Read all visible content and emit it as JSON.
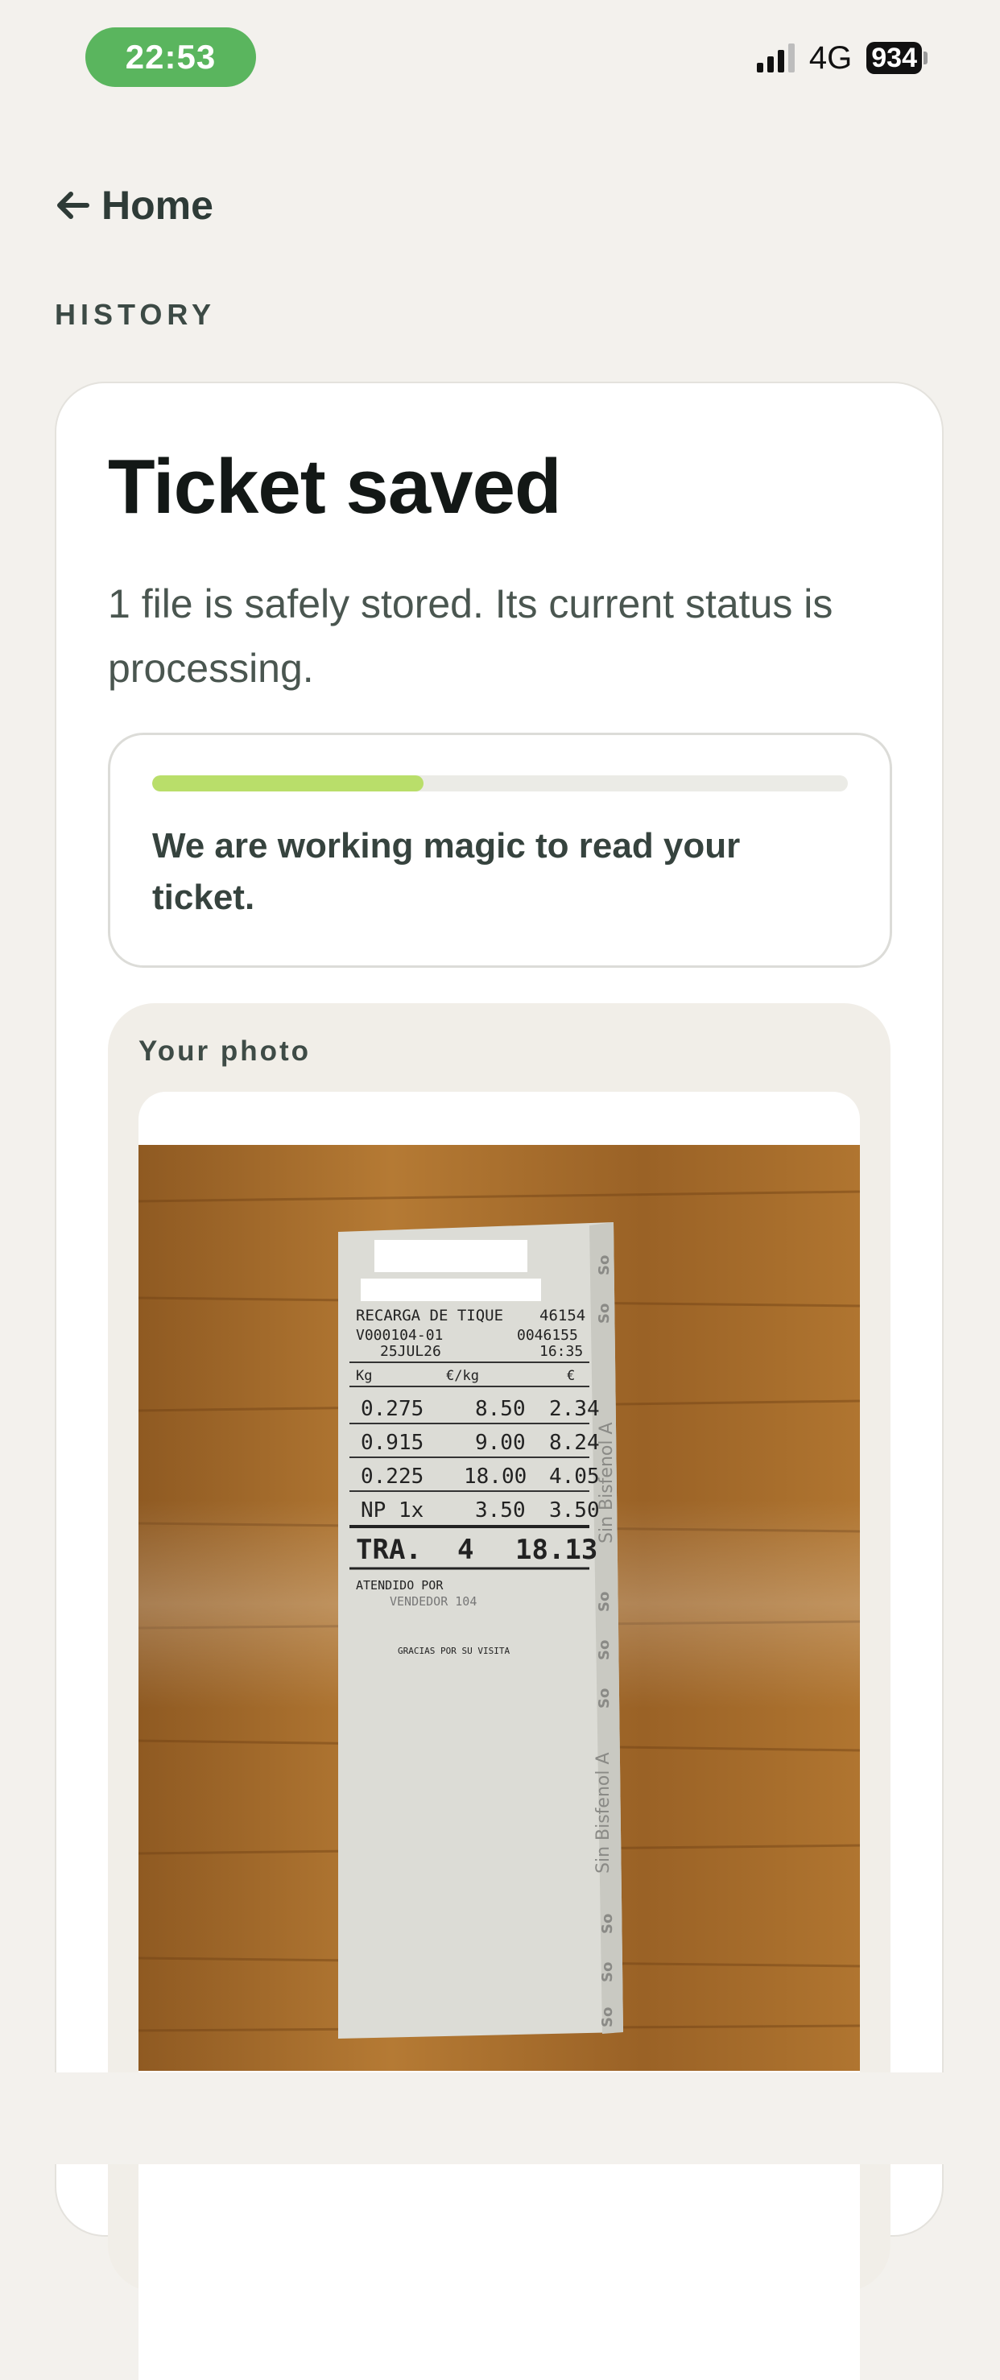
{
  "status_bar": {
    "time": "22:53",
    "network": "4G",
    "battery": "934"
  },
  "nav": {
    "back_label": "Home"
  },
  "section": {
    "label": "HISTORY"
  },
  "ticket": {
    "title": "Ticket saved",
    "description": "1 file is safely stored. Its current status is processing.",
    "progress_fraction": 0.39,
    "progress_message": "We are working magic to read your ticket."
  },
  "photo": {
    "label": "Your photo",
    "receipt": {
      "header": "RECARGA DE TIQUE",
      "ticket_no": "46154",
      "terminal": "V000104-01",
      "ref": "0046155",
      "date": "25JUL26",
      "time": "16:35",
      "col_kg": "Kg",
      "col_price": "€/kg",
      "col_total": "€",
      "rows": [
        {
          "qty": "0.275",
          "price": "8.50",
          "total": "2.34"
        },
        {
          "qty": "0.915",
          "price": "9.00",
          "total": "8.24"
        },
        {
          "qty": "0.225",
          "price": "18.00",
          "total": "4.05"
        },
        {
          "qty": "NP  1x",
          "price": "3.50",
          "total": "3.50"
        }
      ],
      "total_label": "TRA.",
      "total_count": "4",
      "total_value": "18.13",
      "attended_label": "ATENDIDO POR",
      "seller": "VENDEDOR  104",
      "thanks": "GRACIAS POR SU VISITA",
      "side_text": "Sin Bisfenol A",
      "side_mark": "So"
    }
  }
}
